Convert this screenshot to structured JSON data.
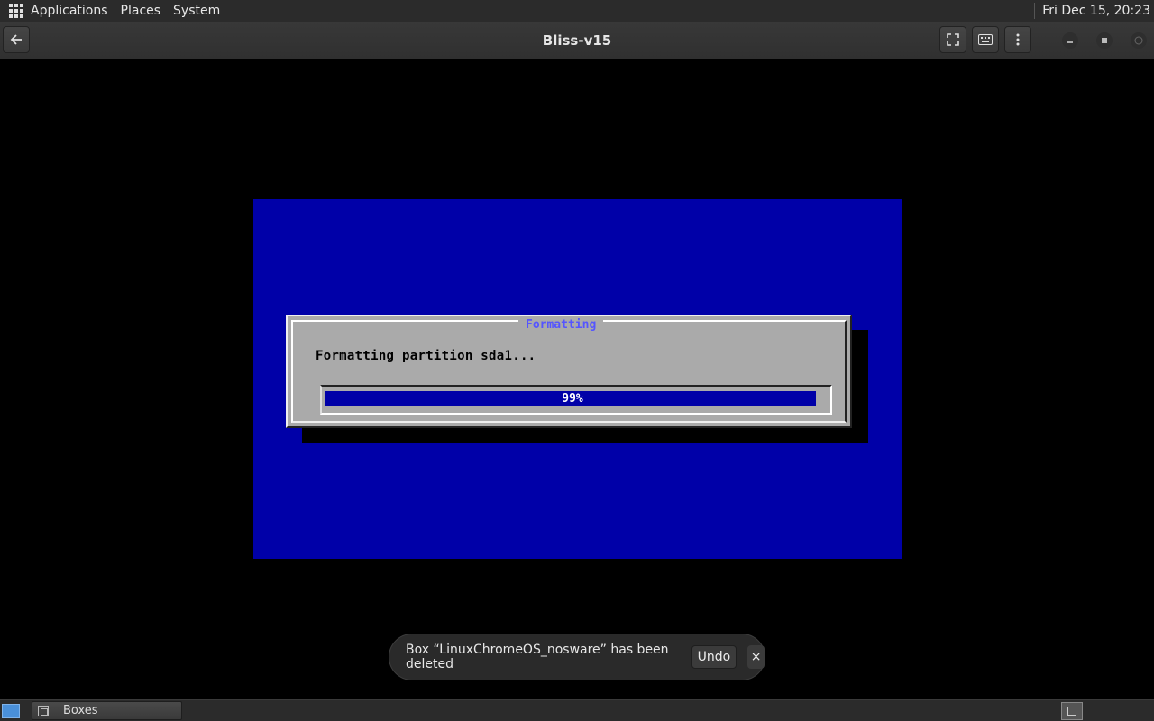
{
  "top_panel": {
    "menu": [
      "Applications",
      "Places",
      "System"
    ],
    "clock": "Fri Dec 15, 20:23",
    "icon": "apps-grid-icon"
  },
  "headerbar": {
    "title": "Bliss-v15",
    "back_icon": "back-arrow-icon",
    "fullscreen_icon": "fullscreen-icon",
    "keyboard_icon": "keyboard-icon",
    "menu_icon": "kebab-menu-icon"
  },
  "vm": {
    "dialog_title": "Formatting",
    "message": "Formatting partition sda1...",
    "progress_label": "99%",
    "progress_value": 0.99,
    "colors": {
      "screen": "#0000a8",
      "dialog": "#aaaaaa",
      "title": "#5555ff"
    }
  },
  "toast": {
    "message": "Box “LinuxChromeOS_nosware” has been deleted",
    "undo_label": "Undo",
    "close_label": "×"
  },
  "taskbar": {
    "task_label": "Boxes"
  }
}
